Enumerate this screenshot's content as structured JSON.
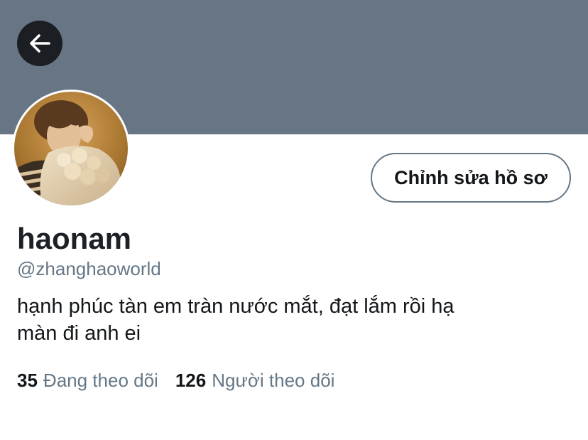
{
  "header": {
    "back_icon": "arrow-left-icon",
    "banner_color": "#687584"
  },
  "profile": {
    "edit_button_label": "Chỉnh sửa hồ sơ",
    "display_name": "haonam",
    "handle": "@zhanghaoworld",
    "bio_line1": "hạnh phúc tàn em tràn nước mắt, đạt lắm rồi hạ",
    "bio_line2": "màn đi anh ei"
  },
  "stats": {
    "following_count": "35",
    "following_label": "Đang theo dõi",
    "followers_count": "126",
    "followers_label": "Người theo dõi"
  },
  "colors": {
    "text_primary": "#14171a",
    "text_secondary": "#657786"
  }
}
